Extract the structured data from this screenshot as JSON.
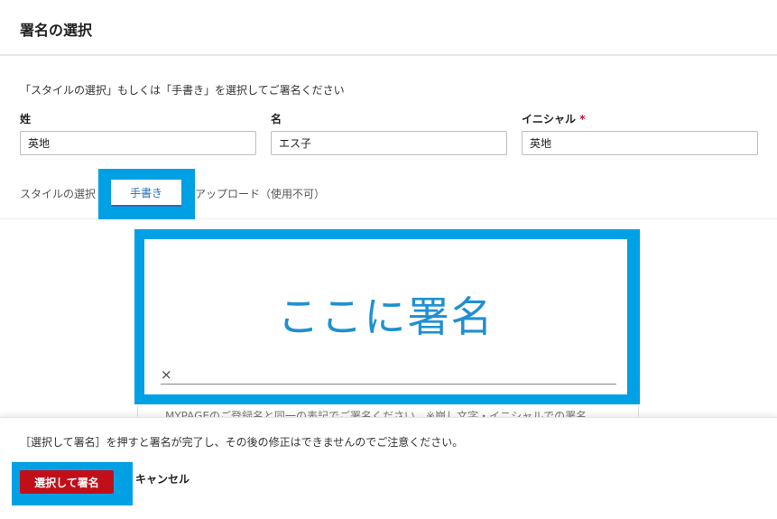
{
  "header": {
    "title": "署名の選択"
  },
  "instruction": "「スタイルの選択」もしくは「手書き」を選択してご署名ください",
  "fields": [
    {
      "label": "姓",
      "required": false,
      "value": "英地"
    },
    {
      "label": "名",
      "required": false,
      "value": "エス子"
    },
    {
      "label": "イニシャル",
      "required": true,
      "required_mark": "*",
      "value": "英地"
    }
  ],
  "tabs": {
    "style": "スタイルの選択",
    "handwriting": "手書き",
    "upload": "アップロード（使用不可）",
    "active": "handwriting"
  },
  "signature_pad": {
    "placeholder": "ここに署名",
    "clear_icon": "×",
    "note": "MYPAGEのご登録名と同一の表記でご署名ください。※崩し文字・イニシャルでの署名"
  },
  "footer": {
    "note": "［選択して署名］を押すと署名が完了し、その後の修正はできませんのでご注意ください。",
    "confirm_label": "選択して署名",
    "cancel_label": "キャンセル"
  },
  "colors": {
    "highlight": "#00a0e4",
    "confirm": "#c10f1a",
    "active_tab": "#2a6fbf",
    "placeholder": "#1e90d2"
  }
}
